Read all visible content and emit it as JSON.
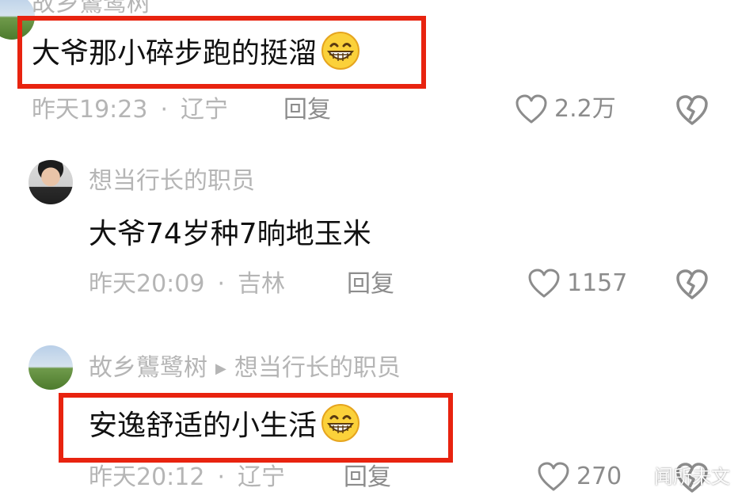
{
  "comments": [
    {
      "username": "故乡鸗鹭树",
      "text": "大爷那小碎步跑的挺溜",
      "emoji": "grinning-face",
      "time": "昨天19:23",
      "location": "辽宁",
      "reply_label": "回复",
      "likes": "2.2万",
      "highlighted": true
    },
    {
      "username": "想当行长的职员",
      "text": "大爷74岁种7晌地玉米",
      "time": "昨天20:09",
      "location": "吉林",
      "reply_label": "回复",
      "likes": "1157",
      "highlighted": false
    },
    {
      "username": "故乡鸗鹭树",
      "reply_to": "想当行长的职员",
      "text": "安逸舒适的小生活",
      "emoji": "grinning-face",
      "time": "昨天20:12",
      "location": "辽宁",
      "reply_label": "回复",
      "likes": "270",
      "highlighted": true
    }
  ],
  "separator": "·",
  "watermark": "闻所未文",
  "colors": {
    "highlight": "#e8230f",
    "muted_text": "#b5b5b5",
    "action_text": "#8c8c8c"
  }
}
